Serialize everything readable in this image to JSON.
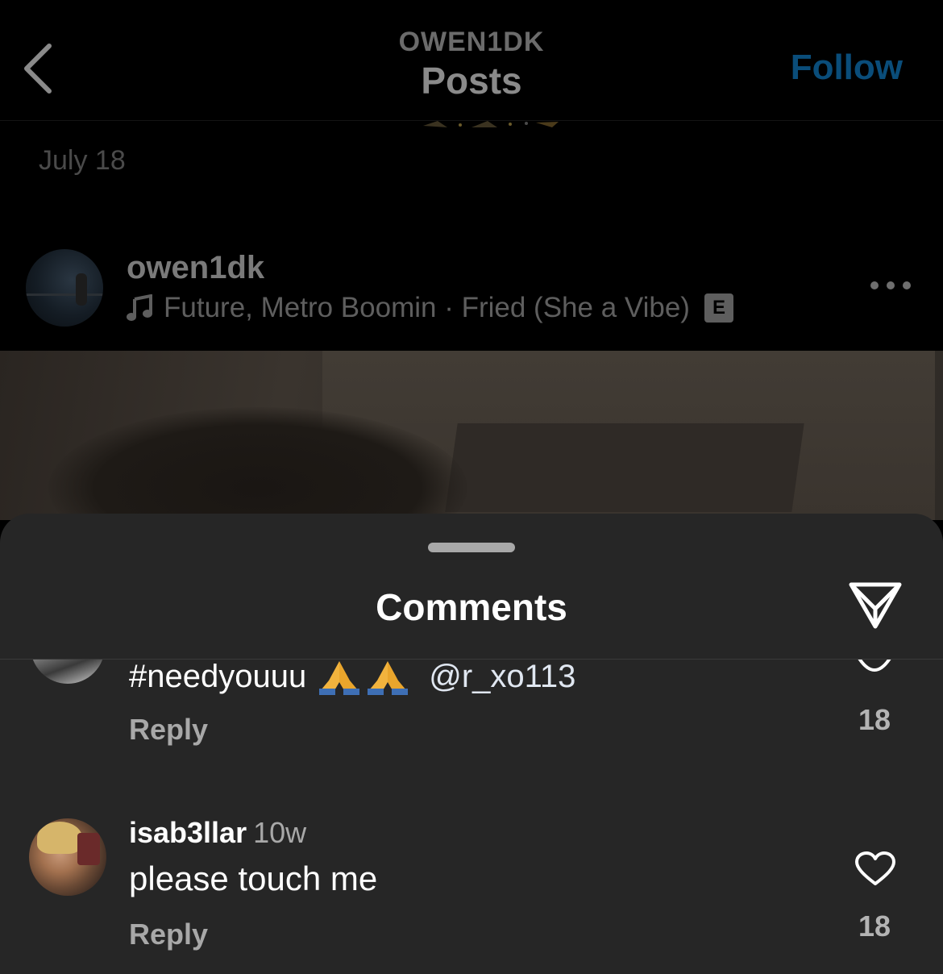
{
  "header": {
    "username": "OWEN1DK",
    "title": "Posts",
    "follow_label": "Follow",
    "back_icon": "chevron-left-icon"
  },
  "post": {
    "date": "July 18",
    "username": "owen1dk",
    "music": "Future, Metro Boomin · Fried (She a Vibe)",
    "explicit_badge": "E",
    "music_icon": "music-note-icon",
    "more_icon": "more-horizontal-icon"
  },
  "comments_sheet": {
    "title": "Comments",
    "share_icon": "send-icon",
    "comments": [
      {
        "hashtag": "#needyouuu",
        "emoji_name": "folded-hands-icon",
        "mention": "@r_xo113",
        "reply_label": "Reply",
        "likes": "18"
      },
      {
        "username": "isab3llar",
        "time": "10w",
        "text": "please touch me",
        "reply_label": "Reply",
        "likes": "18"
      }
    ]
  },
  "colors": {
    "sheet_bg": "#262626",
    "follow_dimmed": "#0a4d7a",
    "page_bg": "#000000"
  }
}
